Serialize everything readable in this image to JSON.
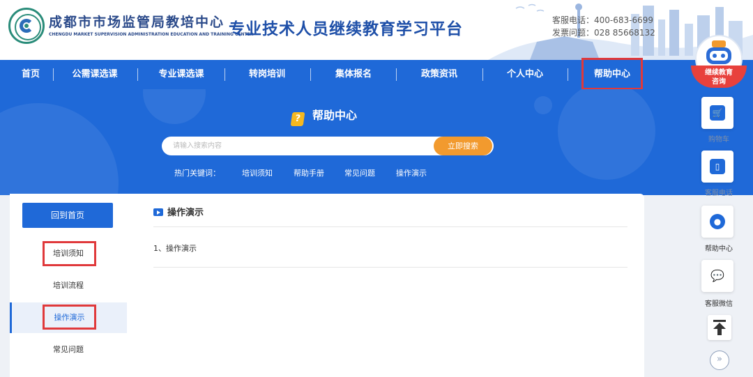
{
  "header": {
    "org_name": "成都市市场监管局教培中心",
    "org_name_en": "CHENGDU MARKET SUPERVISION ADMINISTRATION EDUCATION AND TRAINING CENTER",
    "platform_title": "专业技术人员继续教育学习平台",
    "hotline": "客服电话：400-683-6699",
    "invoice": "发票问题：028 85668132"
  },
  "nav": {
    "items": [
      "首页",
      "公需课选课",
      "专业课选课",
      "转岗培训",
      "集体报名",
      "政策资讯",
      "个人中心",
      "帮助中心"
    ],
    "active": "帮助中心"
  },
  "banner": {
    "title": "帮助中心",
    "search_placeholder": "请输入搜索内容",
    "search_button": "立即搜索",
    "hot_label": "热门关键词：",
    "hot_keywords": [
      "培训须知",
      "帮助手册",
      "常见问题",
      "操作演示"
    ]
  },
  "sidebar": {
    "home_button": "回到首页",
    "items": [
      "培训须知",
      "培训流程",
      "操作演示",
      "常见问题"
    ],
    "active": "操作演示"
  },
  "content": {
    "heading": "操作演示",
    "links": [
      "1、操作演示"
    ]
  },
  "float_bar": {
    "consult_label_line1": "继续教育",
    "consult_label_line2": "咨询",
    "buttons": [
      {
        "label": "购物车",
        "icon": "cart-icon"
      },
      {
        "label": "客服电话",
        "icon": "phone-icon"
      },
      {
        "label": "帮助中心",
        "icon": "bulb-icon"
      },
      {
        "label": "客服微信",
        "icon": "wechat-icon"
      }
    ]
  },
  "colors": {
    "primary": "#1f69d8",
    "accent_orange": "#f29a2e",
    "highlight_red": "#e0393b"
  }
}
